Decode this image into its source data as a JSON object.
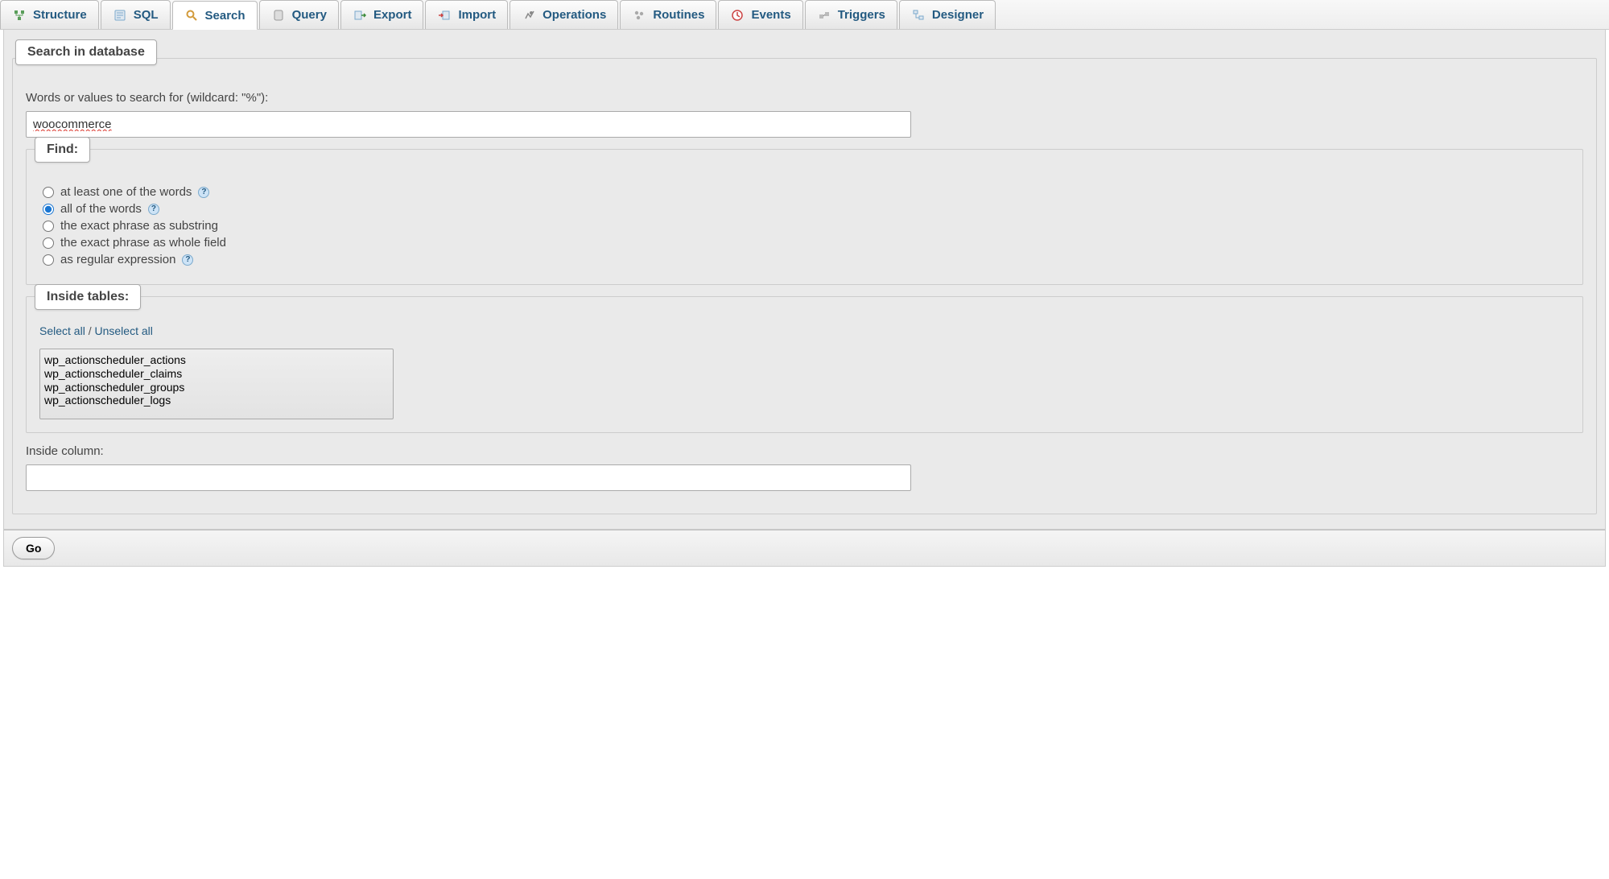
{
  "tabs": [
    {
      "label": "Structure",
      "icon": "structure"
    },
    {
      "label": "SQL",
      "icon": "sql"
    },
    {
      "label": "Search",
      "icon": "search",
      "active": true
    },
    {
      "label": "Query",
      "icon": "query"
    },
    {
      "label": "Export",
      "icon": "export"
    },
    {
      "label": "Import",
      "icon": "import"
    },
    {
      "label": "Operations",
      "icon": "operations"
    },
    {
      "label": "Routines",
      "icon": "routines"
    },
    {
      "label": "Events",
      "icon": "events"
    },
    {
      "label": "Triggers",
      "icon": "triggers"
    },
    {
      "label": "Designer",
      "icon": "designer"
    }
  ],
  "panel_title": "Search in database",
  "search_label": "Words or values to search for (wildcard: \"%\"):",
  "search_value": "woocommerce",
  "find": {
    "legend": "Find:",
    "options": [
      {
        "label": "at least one of the words",
        "has_help": true,
        "checked": false
      },
      {
        "label": "all of the words",
        "has_help": true,
        "checked": true
      },
      {
        "label": "the exact phrase as substring",
        "has_help": false,
        "checked": false
      },
      {
        "label": "the exact phrase as whole field",
        "has_help": false,
        "checked": false
      },
      {
        "label": "as regular expression",
        "has_help": true,
        "checked": false
      }
    ]
  },
  "inside_tables": {
    "legend": "Inside tables:",
    "select_all": "Select all",
    "unselect_all": "Unselect all",
    "separator": " / ",
    "tables": [
      "wp_actionscheduler_actions",
      "wp_actionscheduler_claims",
      "wp_actionscheduler_groups",
      "wp_actionscheduler_logs"
    ]
  },
  "inside_column_label": "Inside column:",
  "inside_column_value": "",
  "go_label": "Go"
}
